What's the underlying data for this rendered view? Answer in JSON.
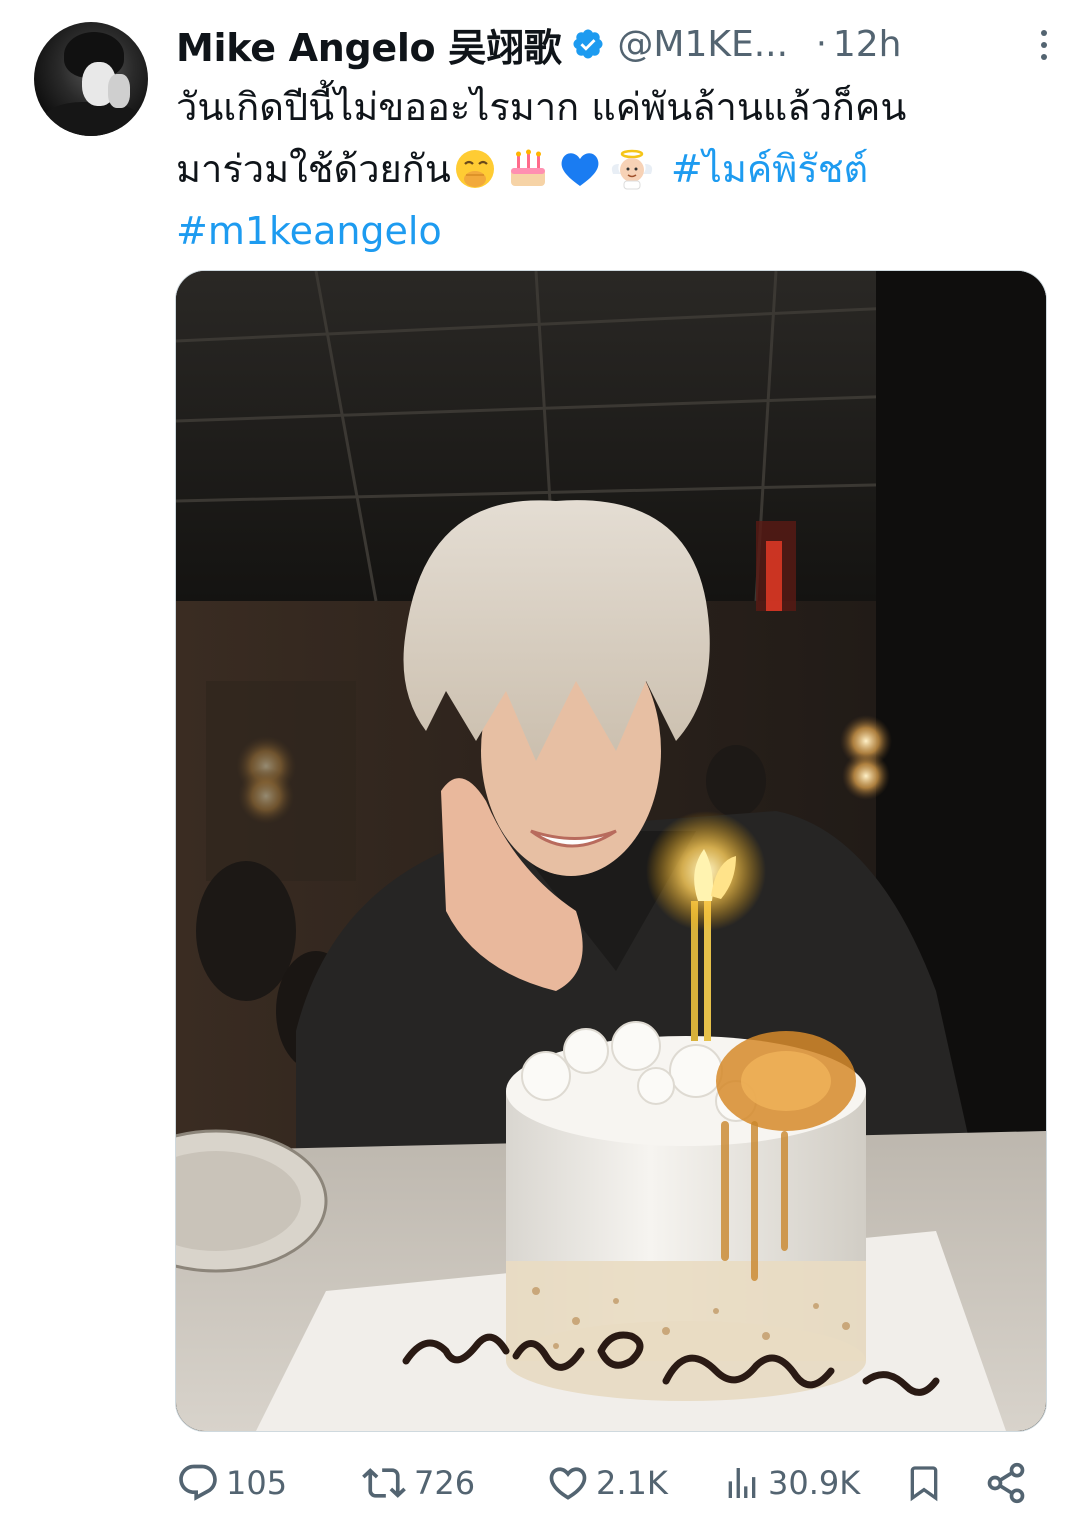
{
  "tweet": {
    "author_name": "Mike Angelo 吴翊歌",
    "handle": "@M1KE...",
    "separator": "·",
    "time": "12h",
    "text_line1": "วันเกิดปีนี้ไม่ขออะไรมาก แค่พันล้านแล้วก็คน",
    "text_line2": "มาร่วมใช้ด้วยกัน",
    "hashtag1": "#ไมค์พิรัชต์",
    "hashtag2": "#m1keangelo",
    "emojis": [
      "hand-over-mouth-emoji",
      "birthday-cake-emoji",
      "blue-heart-emoji",
      "baby-angel-emoji"
    ]
  },
  "actions": {
    "replies": "105",
    "reposts": "726",
    "likes": "2.1K",
    "views": "30.9K"
  },
  "colors": {
    "link": "#1d9bf0",
    "muted": "#536471",
    "verified": "#1d9bf0"
  }
}
